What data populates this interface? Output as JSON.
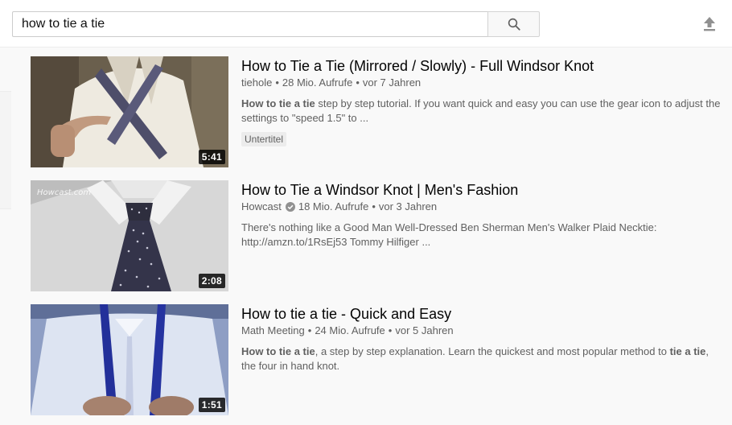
{
  "search": {
    "query": "how to tie a tie"
  },
  "icons": {
    "search": "search-icon",
    "upload": "upload-icon",
    "verified": "verified-check-icon"
  },
  "results": [
    {
      "title": "How to Tie a Tie (Mirrored / Slowly) - Full Windsor Knot",
      "channel": "tiehole",
      "views": "28 Mio. Aufrufe",
      "age": "vor 7 Jahren",
      "duration": "5:41",
      "desc_parts": [
        {
          "text": "How to tie a tie",
          "bold": true
        },
        {
          "text": " step by step tutorial. If you want quick and easy you can use the gear icon to adjust the settings to \"speed 1.5\" to ...",
          "bold": false
        }
      ],
      "badge": "Untertitel"
    },
    {
      "title": "How to Tie a Windsor Knot | Men's Fashion",
      "channel": "Howcast",
      "verified": true,
      "views": "18 Mio. Aufrufe",
      "age": "vor 3 Jahren",
      "duration": "2:08",
      "watermark": "Howcast.com",
      "desc_parts": [
        {
          "text": "There's nothing like a Good Man Well-Dressed Ben Sherman Men's Walker Plaid Necktie: http://amzn.to/1RsEj53 Tommy Hilfiger ...",
          "bold": false
        }
      ]
    },
    {
      "title": "How to tie a tie - Quick and Easy",
      "channel": "Math Meeting",
      "views": "24 Mio. Aufrufe",
      "age": "vor 5 Jahren",
      "duration": "1:51",
      "desc_parts": [
        {
          "text": "How to tie a tie",
          "bold": true
        },
        {
          "text": ", a step by step explanation. Learn the quickest and most popular method to ",
          "bold": false
        },
        {
          "text": "tie a tie",
          "bold": true
        },
        {
          "text": ", the four in hand knot.",
          "bold": false
        }
      ]
    }
  ]
}
